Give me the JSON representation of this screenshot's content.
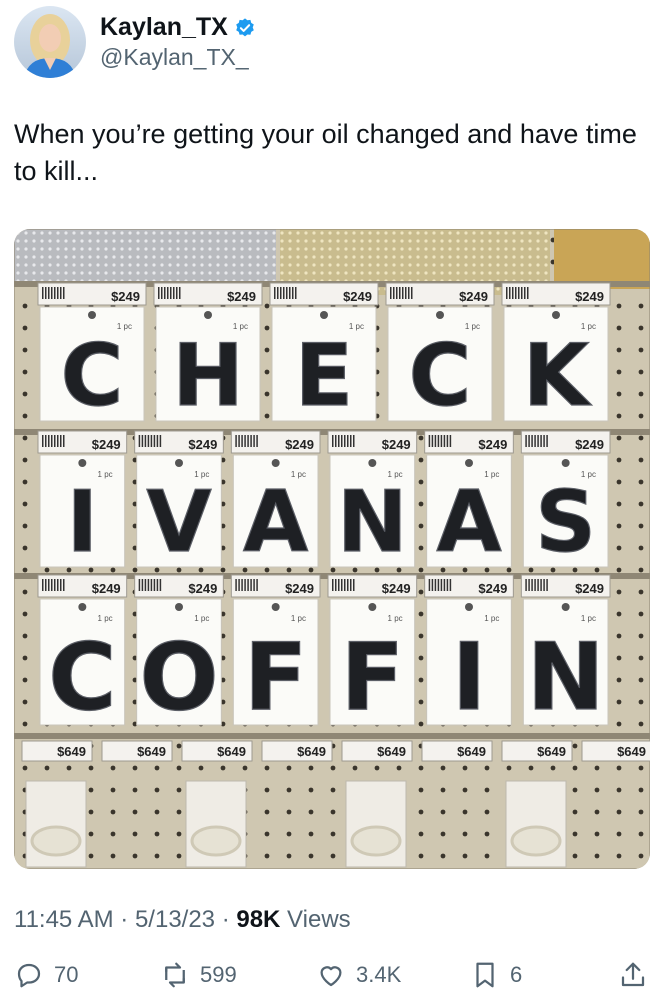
{
  "author": {
    "name": "Kaylan_TX",
    "handle": "@Kaylan_TX_",
    "verified_color": "#1d9bf0",
    "avatar_icon": "profile-photo"
  },
  "tweet": {
    "text": "When you’re getting your oil changed and have time to kill..."
  },
  "photo": {
    "rows": [
      {
        "price": "$249",
        "letters": [
          "C",
          "H",
          "E",
          "C",
          "K"
        ]
      },
      {
        "price": "$249",
        "letters": [
          "I",
          "V",
          "A",
          "N",
          "A",
          "S"
        ]
      },
      {
        "price": "$249",
        "letters": [
          "C",
          "O",
          "F",
          "F",
          "I",
          "N"
        ]
      }
    ],
    "bottom_price": "$649",
    "tag_count": "1 pc"
  },
  "meta": {
    "time": "11:45 AM",
    "sep1": " · ",
    "date": "5/13/23",
    "sep2": " · ",
    "views_count": "98K",
    "views_label": " Views"
  },
  "actions": {
    "replies": "70",
    "reposts": "599",
    "likes": "3.4K",
    "bookmarks": "6",
    "icons": [
      "reply-icon",
      "repost-icon",
      "like-icon",
      "bookmark-icon",
      "share-icon"
    ]
  }
}
